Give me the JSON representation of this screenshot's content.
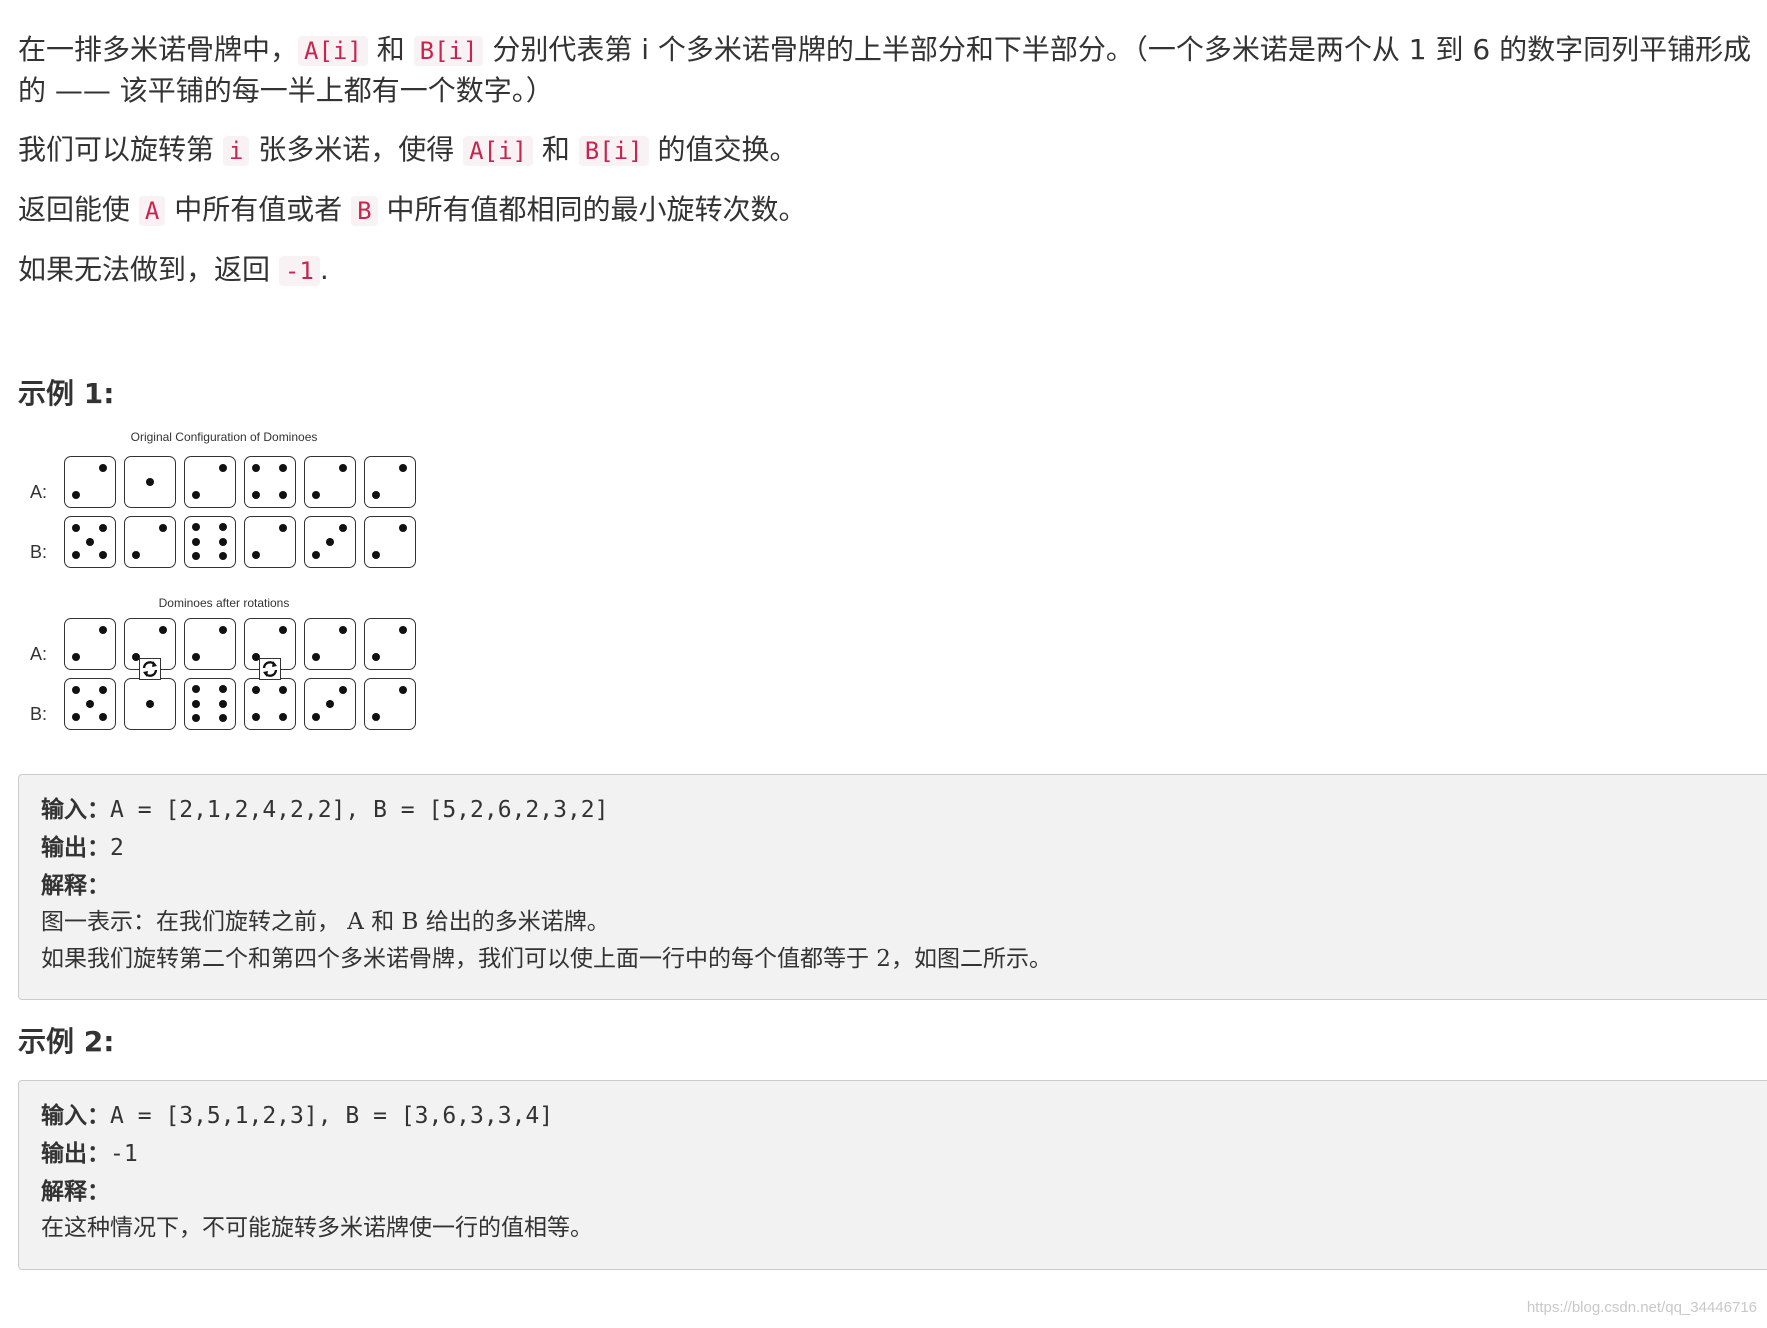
{
  "intro": {
    "p1": {
      "t1": "在一排多米诺骨牌中，",
      "c1": "A[i]",
      "t2": " 和 ",
      "c2": "B[i]",
      "t3": " 分别代表第 i 个多米诺骨牌的上半部分和下半部分。（一个多米诺是两个从 1 到 6 的数字同列平铺形成的 —— 该平铺的每一半上都有一个数字。）"
    },
    "p2": {
      "t1": "我们可以旋转第 ",
      "c1": "i",
      "t2": " 张多米诺，使得 ",
      "c2": "A[i]",
      "t3": " 和 ",
      "c3": "B[i]",
      "t4": " 的值交换。"
    },
    "p3": {
      "t1": "返回能使 ",
      "c1": "A",
      "t2": " 中所有值或者 ",
      "c2": "B",
      "t3": " 中所有值都相同的最小旋转次数。"
    },
    "p4": {
      "t1": "如果无法做到，返回 ",
      "c1": "-1",
      "t2": "."
    }
  },
  "example1": {
    "heading": "示例 1:",
    "figure": {
      "original": {
        "title": "Original Configuration of Dominoes",
        "label_a": "A:",
        "label_b": "B:",
        "top": [
          2,
          1,
          2,
          4,
          2,
          2
        ],
        "bottom": [
          5,
          2,
          6,
          2,
          3,
          2
        ]
      },
      "rotated": {
        "title": "Dominoes after rotations",
        "label_a": "A:",
        "label_b": "B:",
        "top": [
          2,
          2,
          2,
          2,
          2,
          2
        ],
        "bottom": [
          5,
          1,
          6,
          4,
          3,
          2
        ],
        "rotated_indices": [
          1,
          3
        ],
        "rotate_icon": "rotate-arrows-icon"
      }
    },
    "block": {
      "input_label": "输入：",
      "input_value": "A = [2,1,2,4,2,2], B = [5,2,6,2,3,2]",
      "output_label": "输出：",
      "output_value": "2",
      "explain_label": "解释：",
      "line1": "图一表示：在我们旋转之前， A 和 B 给出的多米诺牌。",
      "line2": "如果我们旋转第二个和第四个多米诺骨牌，我们可以使上面一行中的每个值都等于 2，如图二所示。"
    }
  },
  "example2": {
    "heading": "示例 2:",
    "block": {
      "input_label": "输入：",
      "input_value": "A = [3,5,1,2,3], B = [3,6,3,3,4]",
      "output_label": "输出：",
      "output_value": "-1",
      "explain_label": "解释：",
      "line1": "在这种情况下，不可能旋转多米诺牌使一行的值相等。"
    }
  },
  "watermark": "https://blog.csdn.net/qq_34446716"
}
